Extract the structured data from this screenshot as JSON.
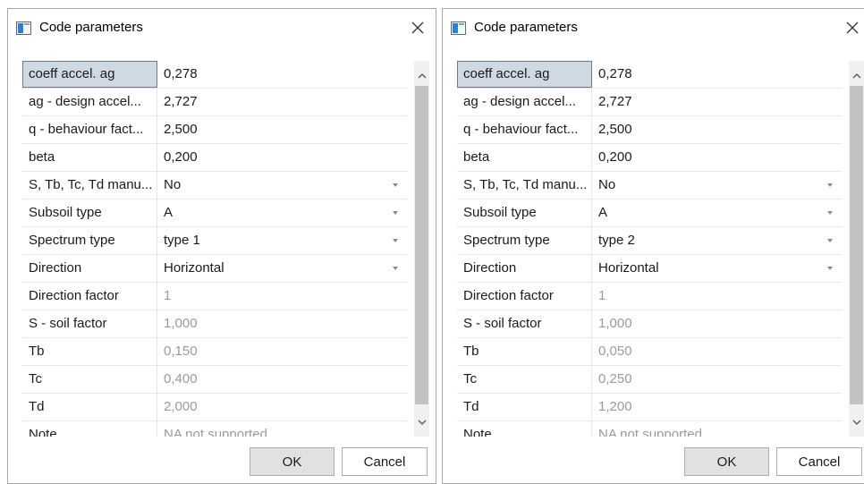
{
  "left_dialog": {
    "title": "Code parameters",
    "rows": [
      {
        "name": "coeff accel. ag",
        "value": "0,278"
      },
      {
        "name": "ag - design accel...",
        "value": "2,727"
      },
      {
        "name": "q - behaviour fact...",
        "value": "2,500"
      },
      {
        "name": "beta",
        "value": "0,200"
      },
      {
        "name": "S, Tb, Tc, Td manu...",
        "value": "No"
      },
      {
        "name": "Subsoil type",
        "value": "A"
      },
      {
        "name": "Spectrum type",
        "value": "type 1"
      },
      {
        "name": "Direction",
        "value": "Horizontal"
      },
      {
        "name": "Direction factor",
        "value": "1"
      },
      {
        "name": "S - soil factor",
        "value": "1,000"
      },
      {
        "name": "Tb",
        "value": "0,150"
      },
      {
        "name": "Tc",
        "value": "0,400"
      },
      {
        "name": "Td",
        "value": "2,000"
      },
      {
        "name": "Note",
        "value": "NA not supported"
      }
    ],
    "ok_label": "OK",
    "cancel_label": "Cancel"
  },
  "right_dialog": {
    "title": "Code parameters",
    "rows": [
      {
        "name": "coeff accel. ag",
        "value": "0,278"
      },
      {
        "name": "ag - design accel...",
        "value": "2,727"
      },
      {
        "name": "q - behaviour fact...",
        "value": "2,500"
      },
      {
        "name": "beta",
        "value": "0,200"
      },
      {
        "name": "S, Tb, Tc, Td manu...",
        "value": "No"
      },
      {
        "name": "Subsoil type",
        "value": "A"
      },
      {
        "name": "Spectrum type",
        "value": "type 2"
      },
      {
        "name": "Direction",
        "value": "Horizontal"
      },
      {
        "name": "Direction factor",
        "value": "1"
      },
      {
        "name": "S - soil factor",
        "value": "1,000"
      },
      {
        "name": "Tb",
        "value": "0,050"
      },
      {
        "name": "Tc",
        "value": "0,250"
      },
      {
        "name": "Td",
        "value": "1,200"
      },
      {
        "name": "Note",
        "value": "NA not supported"
      }
    ],
    "ok_label": "OK",
    "cancel_label": "Cancel"
  },
  "icons": {
    "app": "app-window-icon",
    "close": "close-icon",
    "scroll_up": "chevron-up-icon",
    "scroll_down": "chevron-down-icon",
    "dropdown": "dropdown-arrow-icon"
  },
  "colors": {
    "selected_cell": "#cfd9e4",
    "readonly_text": "#9a9a9a",
    "ok_button": "#e1e1e1",
    "scroll_thumb": "#c2c2c2"
  }
}
